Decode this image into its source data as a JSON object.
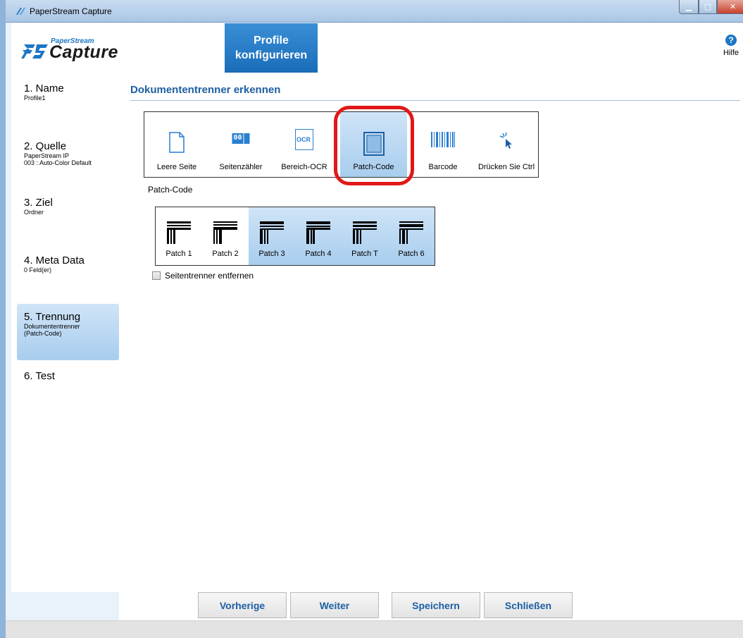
{
  "window": {
    "title": "PaperStream Capture"
  },
  "header": {
    "logo_small": "PaperStream",
    "logo_big": "Capture",
    "step_title_line1": "Profile",
    "step_title_line2": "konfigurieren",
    "help_label": "Hilfe",
    "help_icon": "?"
  },
  "sidebar": {
    "items": [
      {
        "title": "1. Name",
        "sub": "Profile1",
        "active": false
      },
      {
        "title": "2. Quelle",
        "sub": "PaperStream IP\n003 : Auto-Color Default",
        "active": false
      },
      {
        "title": "3. Ziel",
        "sub": "Ordner",
        "active": false
      },
      {
        "title": "4. Meta Data",
        "sub": "0 Feld(er)",
        "active": false
      },
      {
        "title": "5. Trennung",
        "sub": "Dokumententrenner\n(Patch-Code)",
        "active": true
      },
      {
        "title": "6. Test",
        "sub": "",
        "active": false
      }
    ]
  },
  "main": {
    "heading": "Dokumententrenner erkennen",
    "separator_options": [
      {
        "label": "Leere Seite",
        "icon": "blank-page-icon",
        "selected": false
      },
      {
        "label": "Seitenzähler",
        "icon": "page-counter-icon",
        "selected": false
      },
      {
        "label": "Bereich-OCR",
        "icon": "ocr-icon",
        "selected": false
      },
      {
        "label": "Patch-Code",
        "icon": "patch-code-icon",
        "selected": true
      },
      {
        "label": "Barcode",
        "icon": "barcode-icon",
        "selected": false
      },
      {
        "label": "Drücken Sie Ctrl",
        "icon": "click-icon",
        "selected": false
      }
    ],
    "counter_text": "00",
    "ocr_text": "OCR",
    "patch_label": "Patch-Code",
    "patches": [
      {
        "label": "Patch 1",
        "selected": false
      },
      {
        "label": "Patch 2",
        "selected": false
      },
      {
        "label": "Patch 3",
        "selected": true
      },
      {
        "label": "Patch 4",
        "selected": true
      },
      {
        "label": "Patch T",
        "selected": true
      },
      {
        "label": "Patch 6",
        "selected": true
      }
    ],
    "remove_separator_label": "Seitentrenner entfernen",
    "remove_separator_checked": false
  },
  "footer": {
    "prev_label": "Vorherige",
    "next_label": "Weiter",
    "save_label": "Speichern",
    "close_label": "Schließen"
  },
  "colors": {
    "accent": "#1d76c5",
    "heading": "#1d5fa3",
    "highlight": "#e01818",
    "selected_bg": "#b9d7f2"
  }
}
